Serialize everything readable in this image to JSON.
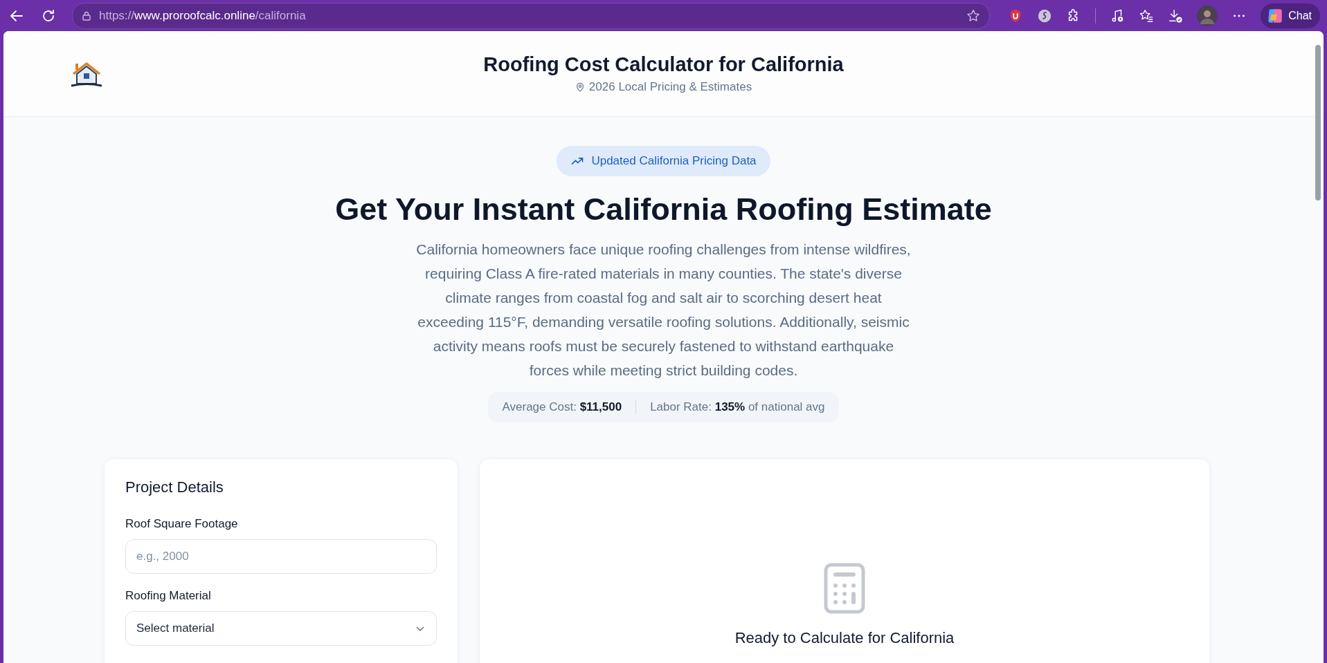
{
  "browser": {
    "url": {
      "scheme": "https://",
      "host": "www.proroofcalc.online",
      "path": "/california"
    },
    "chat_button": "Chat"
  },
  "header": {
    "title": "Roofing Cost Calculator for California",
    "subtitle": "2026 Local Pricing & Estimates"
  },
  "hero": {
    "badge": "Updated California Pricing Data",
    "heading": "Get Your Instant California Roofing Estimate",
    "description": "California homeowners face unique roofing challenges from intense wildfires, requiring Class A fire-rated materials in many counties. The state's diverse climate ranges from coastal fog and salt air to scorching desert heat exceeding 115°F, demanding versatile roofing solutions. Additionally, seismic activity means roofs must be securely fastened to withstand earthquake forces while meeting strict building codes.",
    "stats": [
      "Average Cost: **$11,500**",
      "Labor Rate: **135%** of national avg"
    ]
  },
  "project_details": {
    "title": "Project Details",
    "fields": [
      {
        "kind": "input",
        "label": "Roof Square Footage",
        "placeholder": "e.g., 2000"
      },
      {
        "kind": "select",
        "label": "Roofing Material",
        "value": "Select material"
      }
    ]
  },
  "result_panel": {
    "message": "Ready to Calculate for California"
  }
}
